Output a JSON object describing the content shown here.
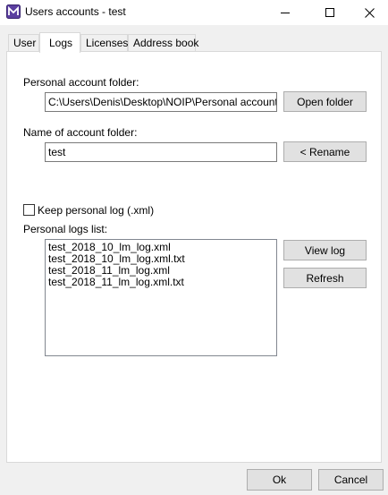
{
  "window": {
    "title": "Users accounts - test",
    "icon": "app-logo-icon",
    "controls": [
      "minimize-icon",
      "maximize-icon",
      "close-icon"
    ]
  },
  "tabs": [
    {
      "label": "User",
      "active": false
    },
    {
      "label": "Logs",
      "active": true
    },
    {
      "label": "Licenses",
      "active": false
    },
    {
      "label": "Address book",
      "active": false
    }
  ],
  "logs": {
    "folder_label": "Personal account folder:",
    "folder_path": "C:\\Users\\Denis\\Desktop\\NOIP\\Personal accounts\\tes",
    "open_folder_button": "Open folder",
    "name_label": "Name of account folder:",
    "name_value": "test",
    "rename_button": "< Rename",
    "keep_log_label": "Keep personal log (.xml)",
    "keep_log_checked": false,
    "list_label": "Personal logs list:",
    "log_files": [
      "test_2018_10_lm_log.xml",
      "test_2018_10_lm_log.xml.txt",
      "test_2018_11_lm_log.xml",
      "test_2018_11_lm_log.xml.txt"
    ],
    "view_log_button": "View log",
    "refresh_button": "Refresh"
  },
  "footer": {
    "ok_button": "Ok",
    "cancel_button": "Cancel"
  },
  "colors": {
    "window_bg": "#f0f0f0",
    "panel_bg": "#ffffff",
    "button_bg": "#e1e1e1",
    "icon_accent": "#5b3fa0"
  }
}
